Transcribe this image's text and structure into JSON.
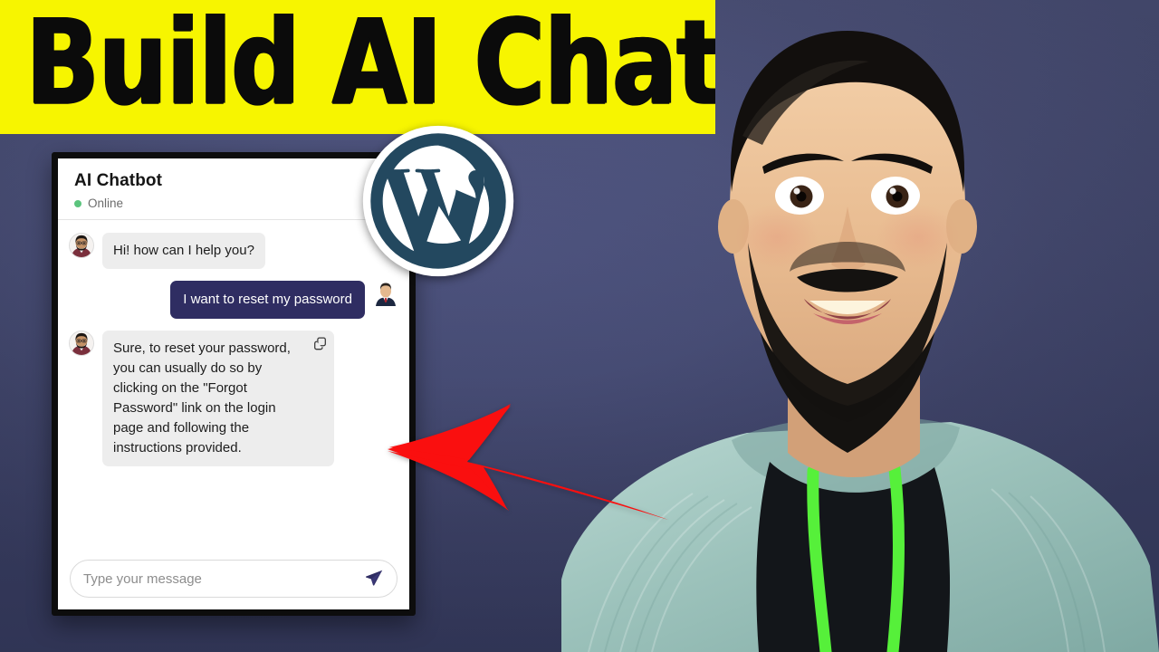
{
  "banner": {
    "title": "Build AI Chatbot",
    "background_color": "#f7f500",
    "text_color": "#0b0b0b"
  },
  "brand": {
    "logo_name": "wordpress-logo",
    "logo_color": "#23485f",
    "logo_mark_color": "#ffffff"
  },
  "annotation": {
    "arrow_name": "red-arrow-pointing-left",
    "arrow_color": "#fa0f0f"
  },
  "background": {
    "gradient_from": "#4d5383",
    "gradient_to": "#3a4066"
  },
  "portrait": {
    "alt": "Smiling bearded man in teal hoodie",
    "hoodie_color": "#9fc4bd",
    "drawstring_color": "#56f03a",
    "shirt_color": "#111418"
  },
  "chat": {
    "title": "AI Chatbot",
    "status": "Online",
    "status_color": "#5bc47d",
    "accent_color": "#2f2d62",
    "bot_bubble_color": "#ededed",
    "messages": [
      {
        "sender": "bot",
        "text": "Hi! how can I help you?",
        "has_copy": false,
        "avatar_name": "bot-avatar"
      },
      {
        "sender": "user",
        "text": "I want to reset my password",
        "has_copy": false,
        "avatar_name": "user-avatar"
      },
      {
        "sender": "bot",
        "text": "Sure, to reset your password, you can usually do so by clicking on the \"Forgot Password\" link on the login page and following the instructions provided.",
        "has_copy": true,
        "avatar_name": "bot-avatar"
      }
    ],
    "composer": {
      "placeholder": "Type your message",
      "value": "",
      "send_icon": "paper-plane-send-icon",
      "send_icon_color": "#2f2d62",
      "copy_icon": "copy-icon"
    }
  }
}
